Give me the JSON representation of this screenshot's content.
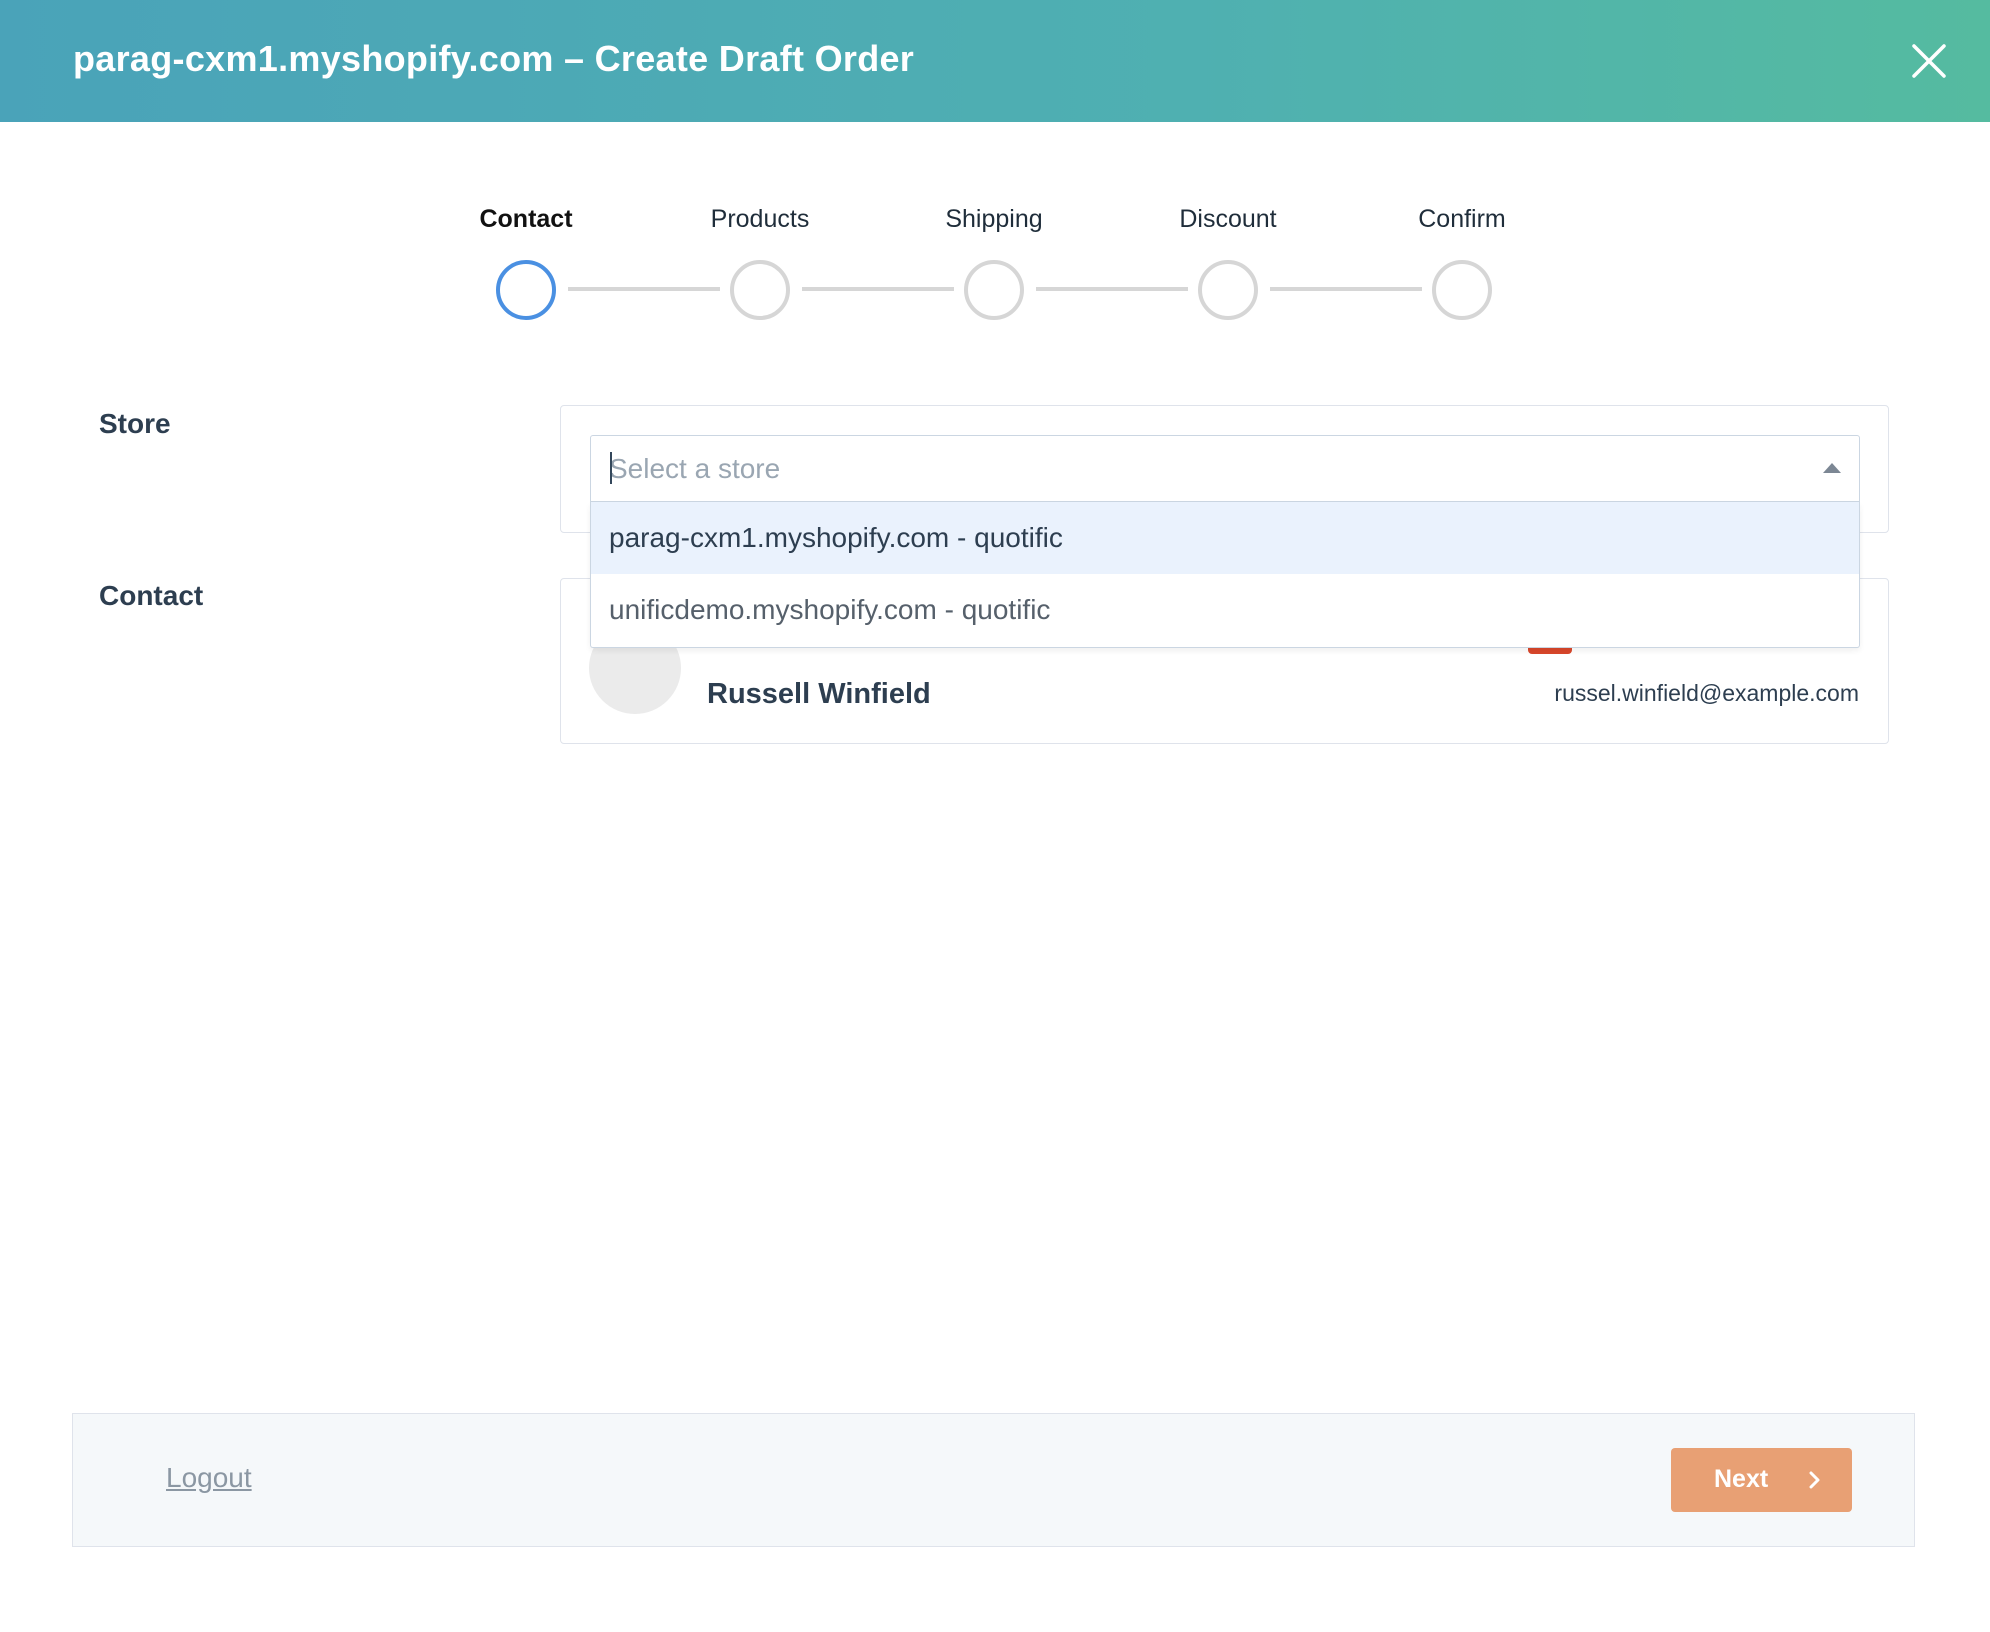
{
  "header": {
    "title": "parag-cxm1.myshopify.com – Create Draft Order",
    "close_icon": "close-icon"
  },
  "stepper": {
    "steps": [
      {
        "label": "Contact",
        "active": true
      },
      {
        "label": "Products",
        "active": false
      },
      {
        "label": "Shipping",
        "active": false
      },
      {
        "label": "Discount",
        "active": false
      },
      {
        "label": "Confirm",
        "active": false
      }
    ],
    "active_color": "#4a90e2"
  },
  "form": {
    "store_label": "Store",
    "contact_label": "Contact",
    "store_select": {
      "placeholder": "Select a store",
      "value": "",
      "options": [
        "parag-cxm1.myshopify.com - quotific",
        "unificdemo.myshopify.com - quotific"
      ]
    },
    "contact_card": {
      "name": "Russell Winfield",
      "email": "russel.winfield@example.com"
    }
  },
  "footer": {
    "logout_label": "Logout",
    "next_label": "Next",
    "next_icon": "chevron-right-icon"
  },
  "colors": {
    "header_gradient_start": "#4aa3b9",
    "header_gradient_end": "#55bba0",
    "next_button": "#e8a074",
    "highlighted_option": "#eaf2fd"
  }
}
